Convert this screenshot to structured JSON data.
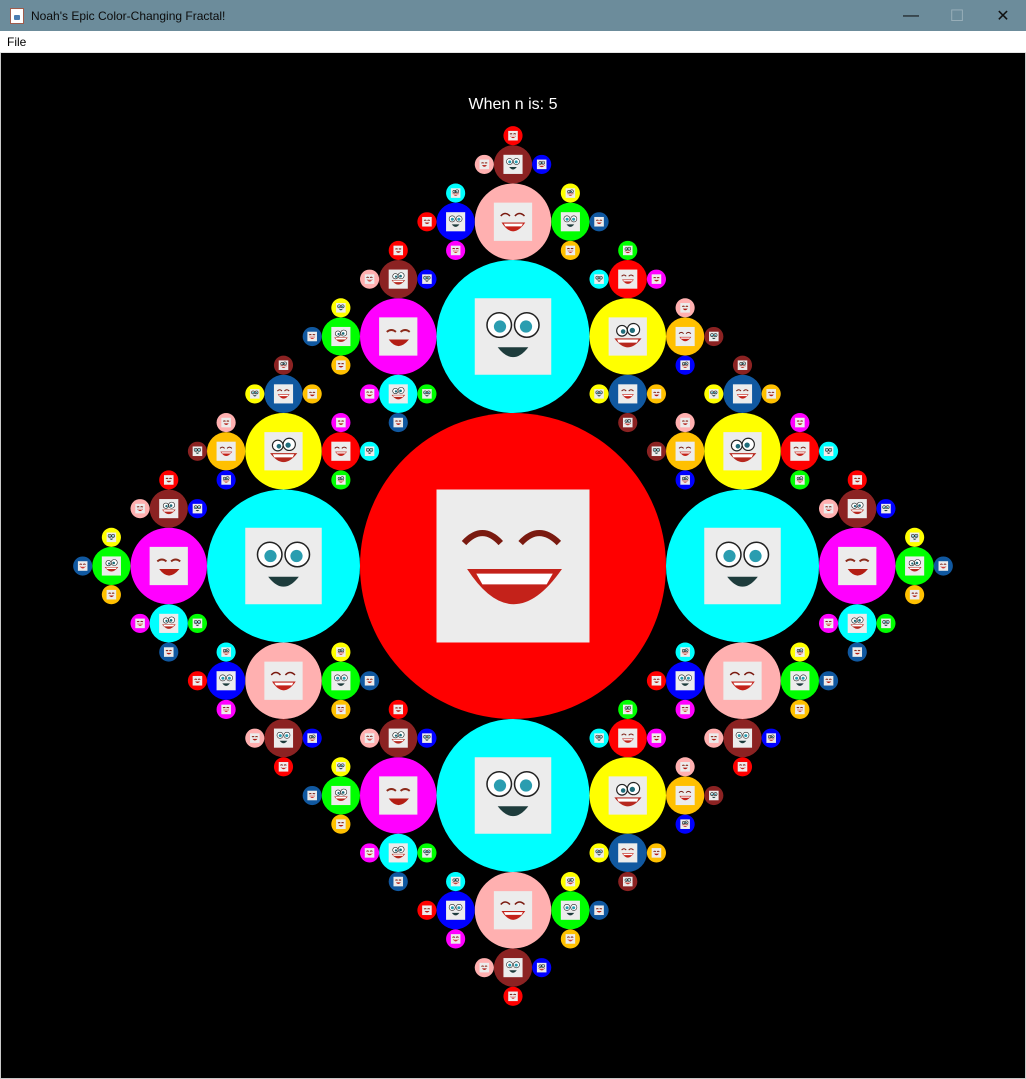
{
  "window": {
    "title": "Noah's Epic Color-Changing Fractal!",
    "controls": {
      "minimize": "—",
      "maximize": "☐",
      "close": "✕"
    }
  },
  "menu": {
    "items": [
      "File"
    ]
  },
  "canvas": {
    "label": "When n is: 5",
    "background": "#000000"
  },
  "fractal": {
    "n": 5,
    "palette": [
      "#ff0000",
      "#00ffff",
      "#ff00ff",
      "#00ff00",
      "#1058a0",
      "#ffff00",
      "#ffc000",
      "#8b2222",
      "#ffb0b0",
      "#0000ff"
    ],
    "face_icons": [
      "laughing-face-icon",
      "big-eyes-face-icon",
      "smiling-face-icon",
      "grinning-face-icon"
    ]
  }
}
